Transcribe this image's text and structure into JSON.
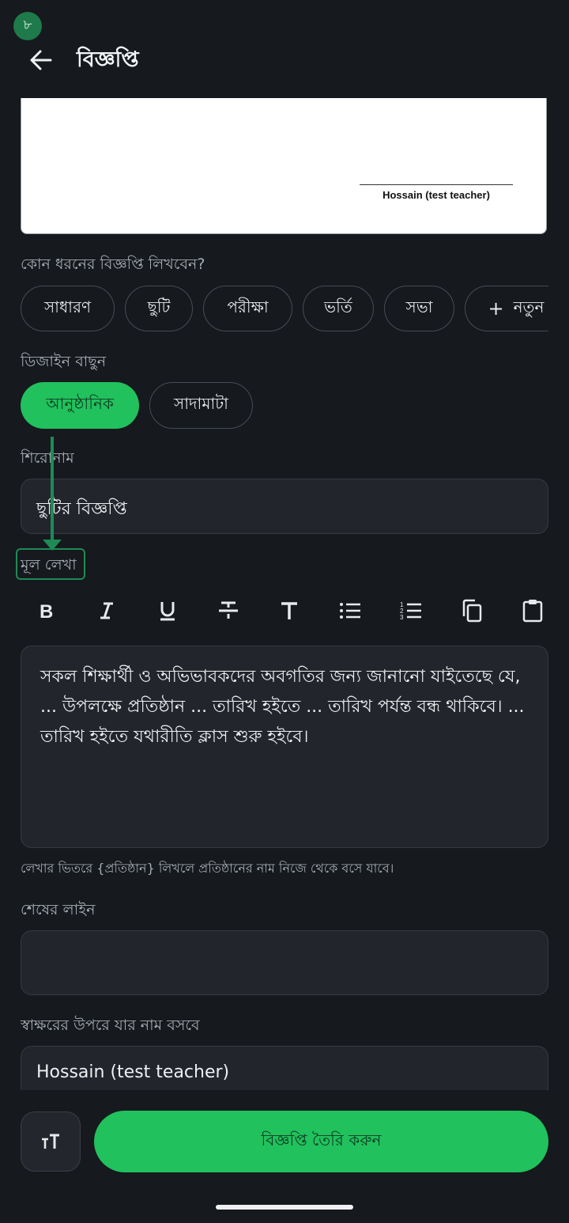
{
  "status": {
    "badge": "৮"
  },
  "header": {
    "title": "বিজ্ঞপ্তি",
    "back_icon": "arrow-left-icon"
  },
  "preview": {
    "signature_name": "Hossain (test teacher)"
  },
  "type_section": {
    "label": "কোন ধরনের বিজ্ঞপ্তি লিখবেন?",
    "chips": [
      "সাধারণ",
      "ছুটি",
      "পরীক্ষা",
      "ভর্তি",
      "সভা"
    ],
    "new_chip": {
      "icon": "+",
      "label": "নতুন"
    }
  },
  "design_section": {
    "label": "ডিজাইন বাছুন",
    "options": [
      "আনুষ্ঠানিক",
      "সাদামাটা"
    ],
    "selected": "আনুষ্ঠানিক"
  },
  "heading_section": {
    "label": "শিরোনাম",
    "value": "ছুটির বিজ্ঞপ্তি"
  },
  "body_section": {
    "label": "মূল লেখা",
    "toolbar": [
      "bold-icon",
      "italic-icon",
      "underline-icon",
      "strikethrough-icon",
      "text-icon",
      "bullet-list-icon",
      "numbered-list-icon",
      "copy-icon",
      "paste-icon"
    ],
    "value": "সকল শিক্ষার্থী ও অভিভাবকদের অবগতির জন্য জানানো যাইতেছে যে, ... উপলক্ষে প্রতিষ্ঠান ... তারিখ হইতে ... তারিখ পর্যন্ত বন্ধ থাকিবে। ... তারিখ হইতে যথারীতি ক্লাস শুরু হইবে।",
    "helper": "লেখার ভিতরে {প্রতিষ্ঠান} লিখলে প্রতিষ্ঠানের নাম নিজে থেকে বসে যাবে।"
  },
  "closing_section": {
    "label": "শেষের লাইন",
    "value": ""
  },
  "signature_section": {
    "label": "স্বাক্ষরের উপরে যার নাম বসবে",
    "value": "Hossain (test teacher)"
  },
  "footer": {
    "text_size_icon": "text-size-icon",
    "create_label": "বিজ্ঞপ্তি তৈরি করুন"
  },
  "colors": {
    "accent": "#21c15d",
    "background": "#16191d",
    "field": "#22262c"
  }
}
